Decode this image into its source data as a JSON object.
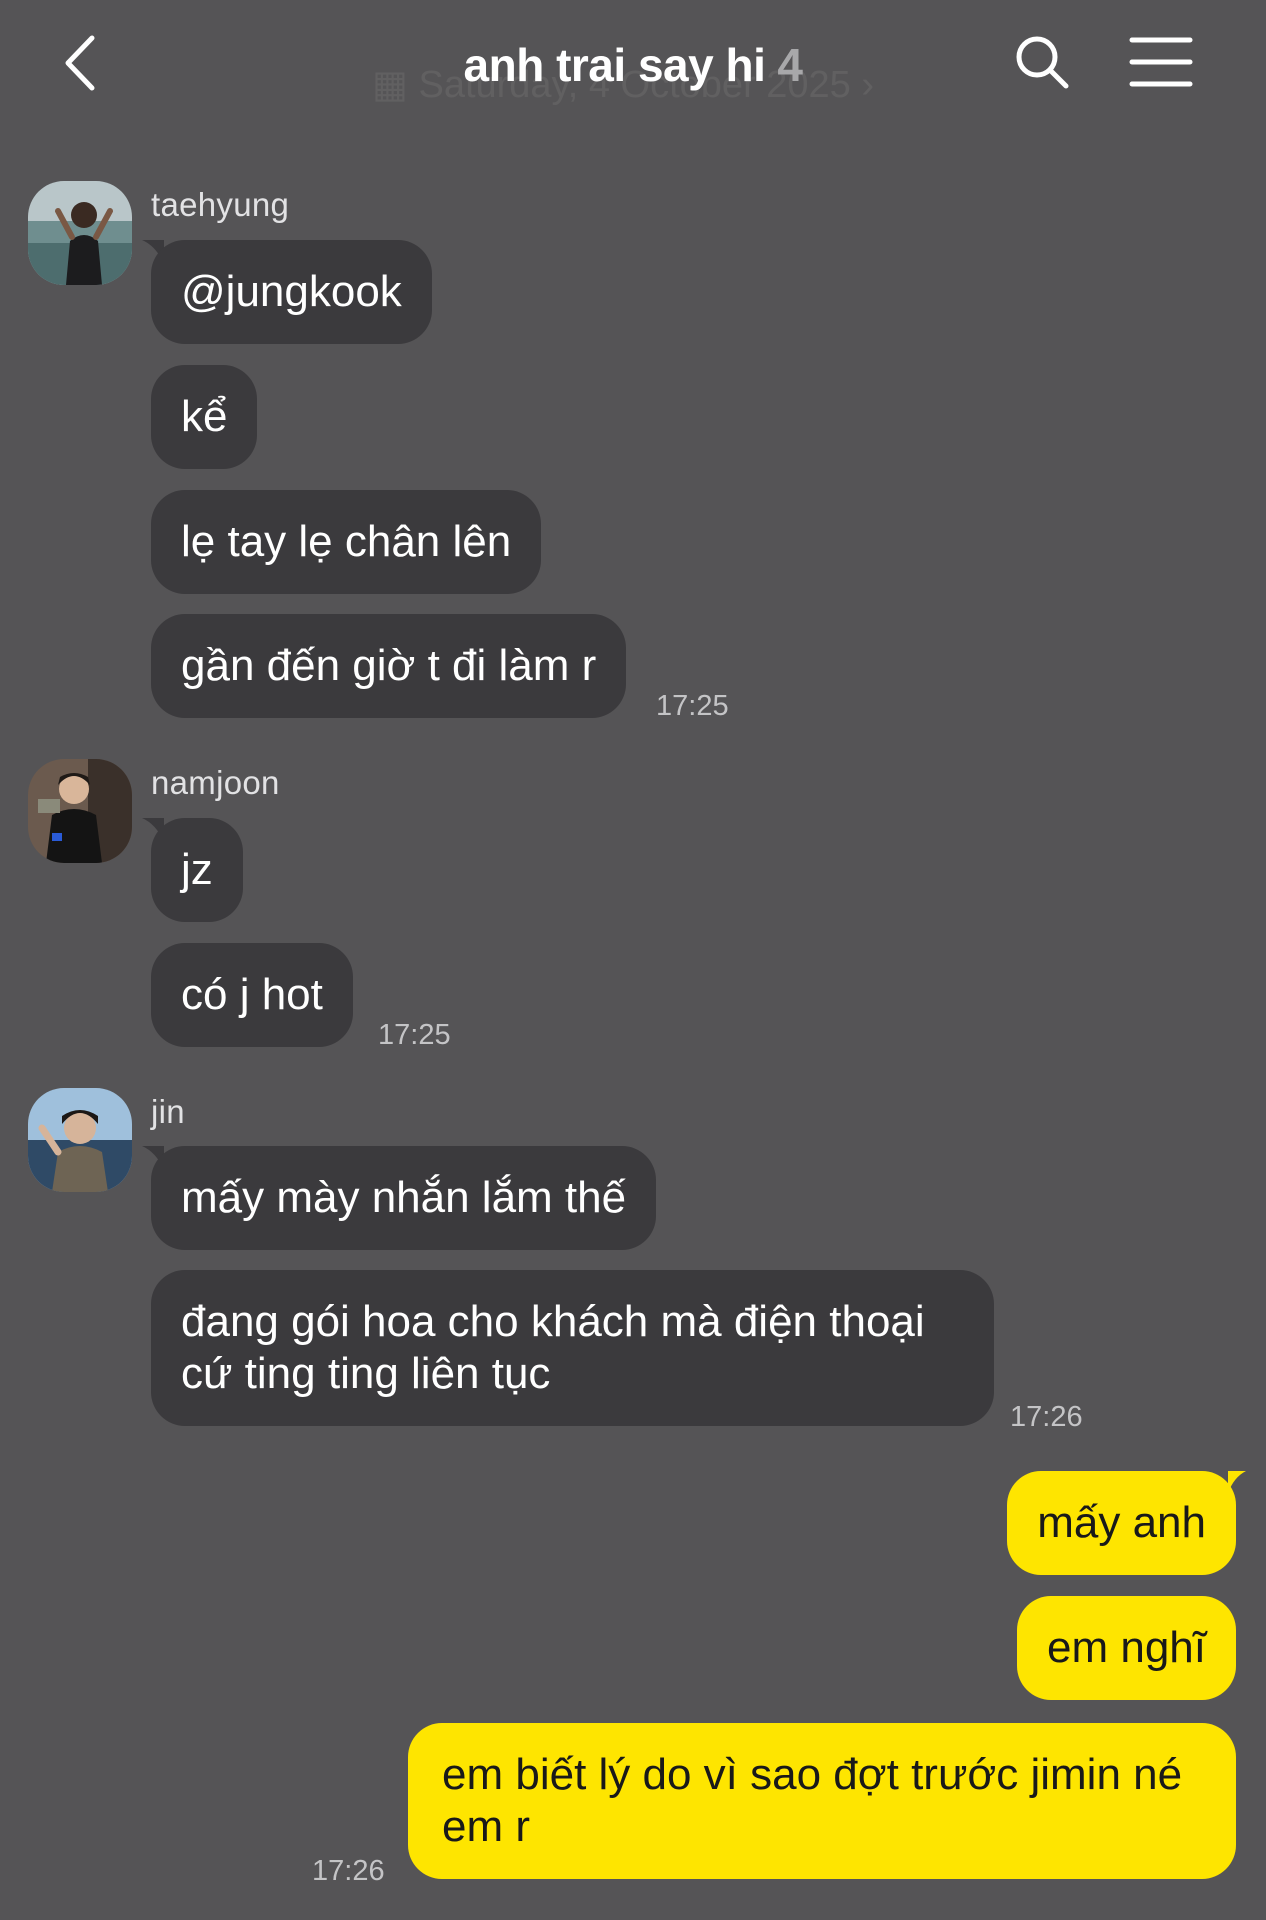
{
  "header": {
    "title": "anh trai say hi",
    "member_count": "4",
    "date_overlay": "Saturday, 4 October 2025"
  },
  "colors": {
    "background": "#555456",
    "incoming_bubble": "#3b3a3d",
    "outgoing_bubble": "#fee500"
  },
  "messages": {
    "taehyung": {
      "name": "taehyung",
      "texts": [
        "@jungkook",
        "kể",
        "lẹ tay lẹ chân lên",
        "gần đến giờ t đi làm r"
      ],
      "time": "17:25"
    },
    "namjoon": {
      "name": "namjoon",
      "texts": [
        "jz",
        "có j hot"
      ],
      "time": "17:25"
    },
    "jin": {
      "name": "jin",
      "texts": [
        "mấy mày nhắn lắm thế",
        "đang gói hoa cho khách mà điện thoại cứ ting ting liên tục"
      ],
      "time": "17:26"
    },
    "me": {
      "texts": [
        "mấy anh",
        "em nghĩ",
        "em biết lý do vì sao đợt trước jimin né em r"
      ],
      "time": "17:26"
    }
  }
}
